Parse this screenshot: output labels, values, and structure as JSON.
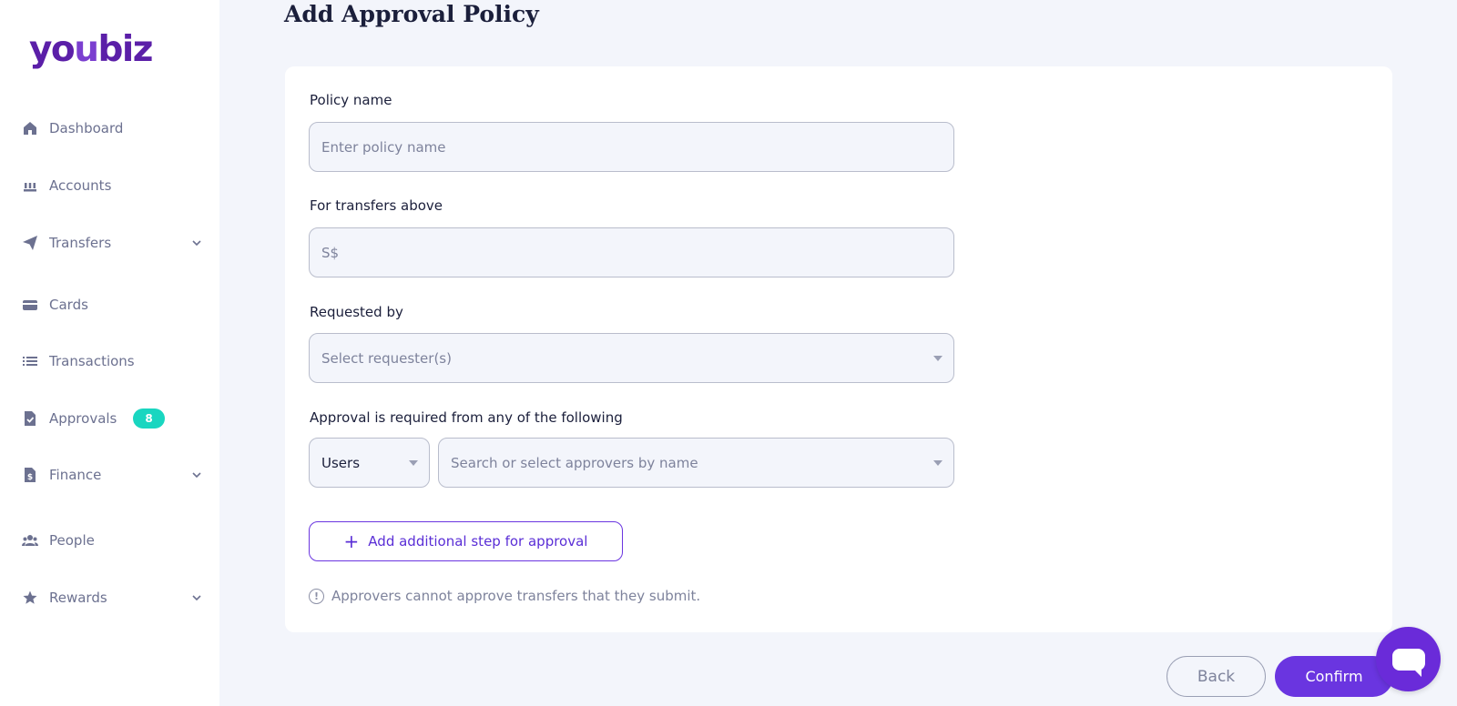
{
  "logo": {
    "part1": "yo",
    "part2": "u",
    "part3": "biz"
  },
  "sidebar": {
    "items": [
      {
        "label": "Dashboard",
        "icon": "home-icon"
      },
      {
        "label": "Accounts",
        "icon": "bank-icon"
      },
      {
        "label": "Transfers",
        "icon": "send-icon",
        "expandable": true
      },
      {
        "label": "Cards",
        "icon": "card-icon"
      },
      {
        "label": "Transactions",
        "icon": "list-icon"
      },
      {
        "label": "Approvals",
        "icon": "approval-icon",
        "badge": "8"
      },
      {
        "label": "Finance",
        "icon": "invoice-icon",
        "expandable": true
      },
      {
        "label": "People",
        "icon": "people-icon"
      },
      {
        "label": "Rewards",
        "icon": "star-icon",
        "expandable": true
      }
    ]
  },
  "page": {
    "title": "Add Approval Policy"
  },
  "form": {
    "policy_name": {
      "label": "Policy name",
      "placeholder": "Enter policy name",
      "value": ""
    },
    "transfers_above": {
      "label": "For transfers above",
      "placeholder": "S$",
      "value": ""
    },
    "requested_by": {
      "label": "Requested by",
      "placeholder": "Select requester(s)"
    },
    "approval_from": {
      "label": "Approval is required from any of the following",
      "type_value": "Users",
      "approvers_placeholder": "Search or select approvers by name"
    },
    "add_step_label": "Add additional step for approval",
    "info_text": "Approvers cannot approve transfers that they submit."
  },
  "actions": {
    "back_label": "Back",
    "confirm_label": "Confirm"
  },
  "colors": {
    "brand": "#5b1fa8",
    "accent": "#6a35e0",
    "badge": "#19d6c0",
    "background": "#f3f5fb"
  }
}
